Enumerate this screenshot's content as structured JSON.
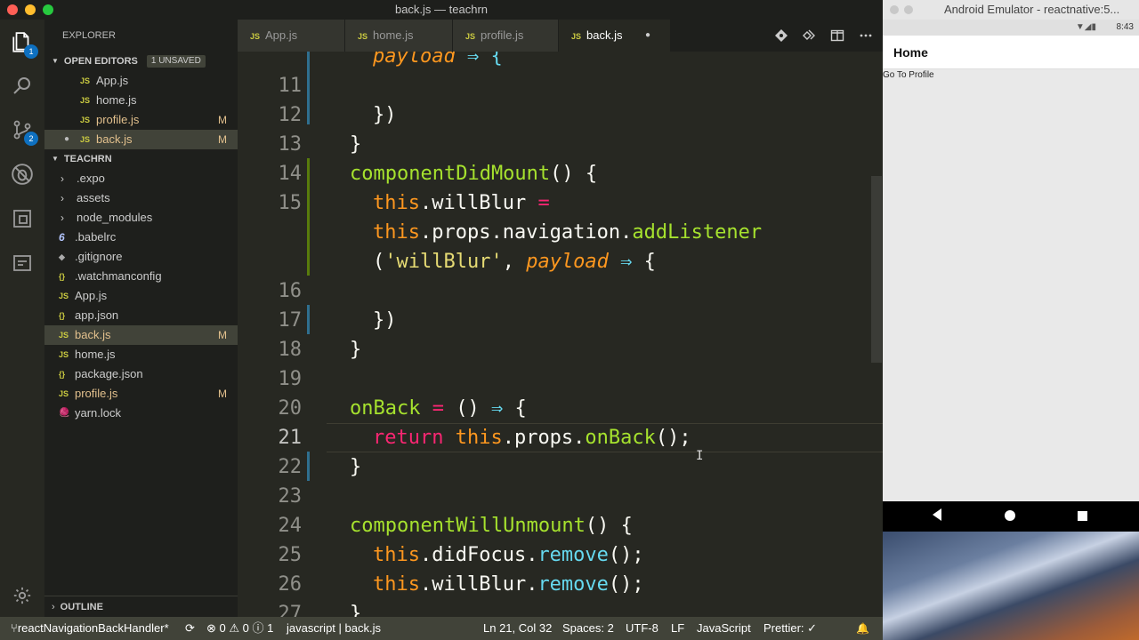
{
  "window": {
    "title": "back.js — teachrn"
  },
  "activity": {
    "explorer_badge": "1",
    "scm_badge": "2"
  },
  "sidebar": {
    "title": "EXPLORER",
    "open_editors": {
      "label": "OPEN EDITORS",
      "badge": "1 UNSAVED",
      "files": [
        {
          "name": "App.js",
          "icon": "JS",
          "status": ""
        },
        {
          "name": "home.js",
          "icon": "JS",
          "status": ""
        },
        {
          "name": "profile.js",
          "icon": "JS",
          "status": "M"
        },
        {
          "name": "back.js",
          "icon": "JS",
          "status": "M"
        }
      ]
    },
    "project": {
      "label": "TEACHRN",
      "items": [
        {
          "name": ".expo",
          "icon": "›"
        },
        {
          "name": "assets",
          "icon": "›"
        },
        {
          "name": "node_modules",
          "icon": "›"
        },
        {
          "name": ".babelrc",
          "icon": "6"
        },
        {
          "name": ".gitignore",
          "icon": "◆"
        },
        {
          "name": ".watchmanconfig",
          "icon": "{}"
        },
        {
          "name": "App.js",
          "icon": "JS"
        },
        {
          "name": "app.json",
          "icon": "{}"
        },
        {
          "name": "back.js",
          "icon": "JS",
          "status": "M"
        },
        {
          "name": "home.js",
          "icon": "JS"
        },
        {
          "name": "package.json",
          "icon": "{}"
        },
        {
          "name": "profile.js",
          "icon": "JS",
          "status": "M"
        },
        {
          "name": "yarn.lock",
          "icon": "🧶"
        }
      ]
    },
    "outline_label": "OUTLINE"
  },
  "tabs": [
    {
      "name": "App.js",
      "icon": "JS"
    },
    {
      "name": "home.js",
      "icon": "JS"
    },
    {
      "name": "profile.js",
      "icon": "JS"
    },
    {
      "name": "back.js",
      "icon": "JS",
      "dirty": "●"
    }
  ],
  "editor": {
    "line_numbers": [
      "11",
      "12",
      "13",
      "14",
      "15",
      "16",
      "17",
      "18",
      "19",
      "20",
      "21",
      "22",
      "23",
      "24",
      "25",
      "26",
      "27"
    ],
    "code": {
      "l10_payload": "payload",
      "l10_arrow": " ⇒ {",
      "l12": "})",
      "l13": "}",
      "l14_fn": "componentDidMount",
      "l14_rest": "() {",
      "l15a_this": "this",
      "l15a_rest": ".willBlur ",
      "l15a_eq": "=",
      "l15b_this": "this",
      "l15b_mid": ".props.navigation.",
      "l15b_fn": "addListener",
      "l15c_open": "(",
      "l15c_str": "'willBlur'",
      "l15c_comma": ", ",
      "l15c_payload": "payload",
      "l15c_arrow": " ⇒ ",
      "l15c_brace": "{",
      "l17": "})",
      "l18": "}",
      "l20_fn": "onBack",
      "l20_eq": " = ",
      "l20_paren": "() ",
      "l20_arrow": "⇒",
      "l20_brace": " {",
      "l21_kw": "return ",
      "l21_this": "this",
      "l21_mid": ".props.",
      "l21_fn": "onBack",
      "l21_rest": "();",
      "l22": "}",
      "l24_fn": "componentWillUnmount",
      "l24_rest": "() {",
      "l25_this": "this",
      "l25_mid": ".didFocus.",
      "l25_fn": "remove",
      "l25_rest": "();",
      "l26_this": "this",
      "l26_mid": ".willBlur.",
      "l26_fn": "remove",
      "l26_rest": "();",
      "l27": "}"
    }
  },
  "statusbar": {
    "branch": "reactNavigationBackHandler*",
    "sync": "⟳",
    "problems": "⊗ 0 ⚠ 0 ⓘ 1",
    "lang_icon": "javascript | back.js",
    "position": "Ln 21, Col 32",
    "spaces": "Spaces: 2",
    "encoding": "UTF-8",
    "eol": "LF",
    "language": "JavaScript",
    "prettier": "Prettier: ✓",
    "bell": "🔔"
  },
  "emulator": {
    "title": "Android Emulator - reactnative:5...",
    "time": "8:43",
    "app_title": "Home",
    "link": "Go To Profile"
  },
  "colors": {
    "bg": "#272822",
    "sidebar": "#1e1f1c",
    "status": "#414339",
    "accent": "#0e70c0"
  }
}
